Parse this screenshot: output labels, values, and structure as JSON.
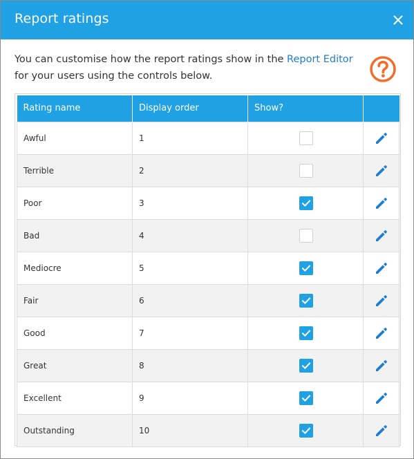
{
  "dialog": {
    "title": "Report ratings",
    "intro_before": "You can customise how the report ratings show in the ",
    "intro_link": "Report Editor",
    "intro_after": " for your users using the controls below."
  },
  "table": {
    "headers": [
      "Rating name",
      "Display order",
      "Show?",
      ""
    ],
    "rows": [
      {
        "name": "Awful",
        "order": "1",
        "show": false
      },
      {
        "name": "Terrible",
        "order": "2",
        "show": false
      },
      {
        "name": "Poor",
        "order": "3",
        "show": true
      },
      {
        "name": "Bad",
        "order": "4",
        "show": false
      },
      {
        "name": "Mediocre",
        "order": "5",
        "show": true
      },
      {
        "name": "Fair",
        "order": "6",
        "show": true
      },
      {
        "name": "Good",
        "order": "7",
        "show": true
      },
      {
        "name": "Great",
        "order": "8",
        "show": true
      },
      {
        "name": "Excellent",
        "order": "9",
        "show": true
      },
      {
        "name": "Outstanding",
        "order": "10",
        "show": true
      }
    ]
  },
  "icons": {
    "close": "close-icon",
    "help": "help-icon",
    "edit": "pencil-icon",
    "check": "checkmark-icon"
  },
  "colors": {
    "accent": "#1fa1e3",
    "link": "#1f7ed0",
    "help": "#f26c2a",
    "edit": "#1f7ed0"
  }
}
